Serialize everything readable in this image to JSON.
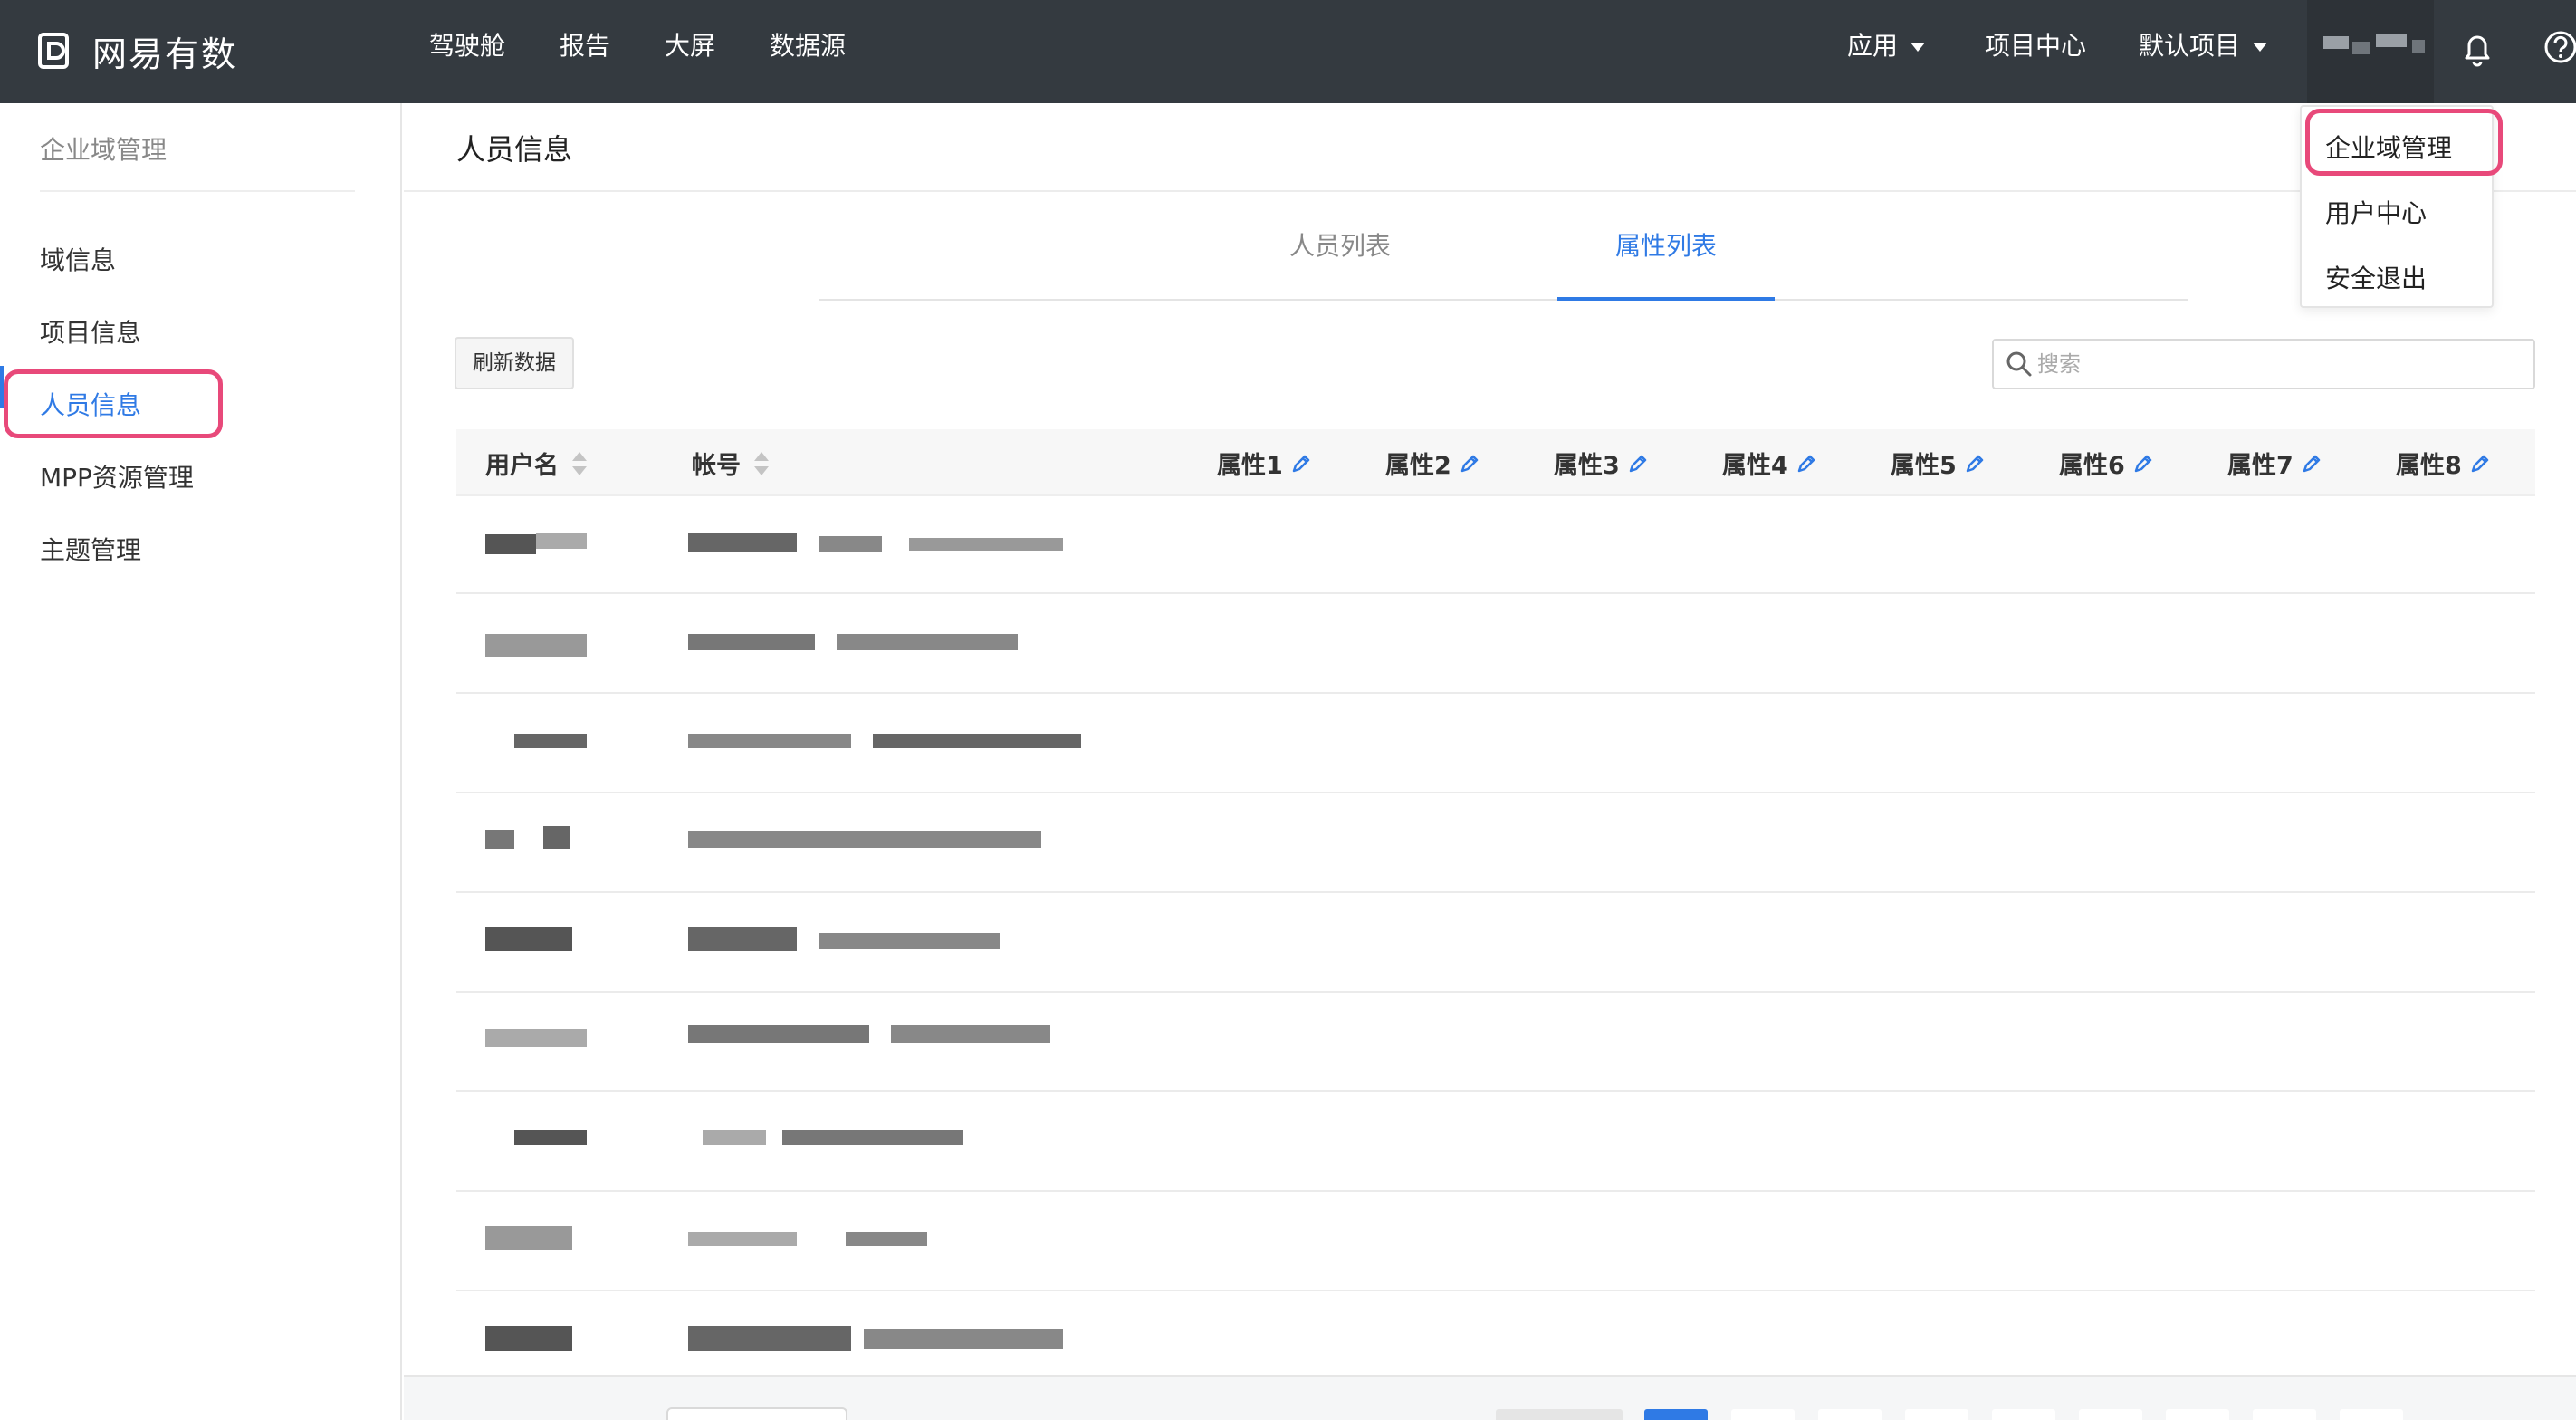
{
  "header": {
    "logo_text": "网易有数",
    "nav": [
      "驾驶舱",
      "报告",
      "大屏",
      "数据源"
    ],
    "right": {
      "apps": "应用",
      "project_center": "项目中心",
      "default_project": "默认项目"
    }
  },
  "user_menu": {
    "items": [
      "企业域管理",
      "用户中心",
      "安全退出"
    ]
  },
  "sidebar": {
    "title": "企业域管理",
    "items": [
      {
        "label": "域信息",
        "active": false
      },
      {
        "label": "项目信息",
        "active": false
      },
      {
        "label": "人员信息",
        "active": true
      },
      {
        "label": "MPP资源管理",
        "active": false
      },
      {
        "label": "主题管理",
        "active": false
      }
    ]
  },
  "main": {
    "title": "人员信息",
    "tabs": [
      {
        "label": "人员列表",
        "active": false
      },
      {
        "label": "属性列表",
        "active": true
      }
    ],
    "refresh_label": "刷新数据",
    "search": {
      "placeholder": "搜索",
      "value": ""
    },
    "table": {
      "columns": [
        "用户名",
        "帐号",
        "属性1",
        "属性2",
        "属性3",
        "属性4",
        "属性5",
        "属性6",
        "属性7",
        "属性8"
      ]
    }
  },
  "colors": {
    "accent": "#2f7ae5",
    "topbar": "#343a40",
    "highlight": "#e8497a"
  },
  "icons": [
    "logo-icon",
    "caret-down-icon",
    "bell-icon",
    "help-icon",
    "search-icon",
    "sort-icon",
    "pencil-icon"
  ]
}
